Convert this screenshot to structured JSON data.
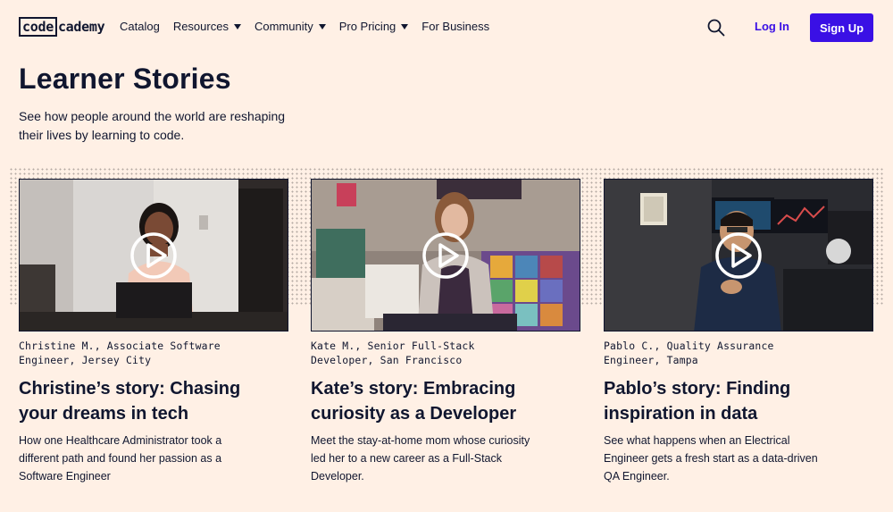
{
  "header": {
    "logo_box": "code",
    "logo_rest": "cademy",
    "nav": [
      {
        "label": "Catalog",
        "dropdown": false
      },
      {
        "label": "Resources",
        "dropdown": true
      },
      {
        "label": "Community",
        "dropdown": true
      },
      {
        "label": "Pro Pricing",
        "dropdown": true
      },
      {
        "label": "For Business",
        "dropdown": false
      }
    ],
    "login": "Log In",
    "signup": "Sign Up"
  },
  "hero": {
    "title": "Learner Stories",
    "subtitle": "See how people around the world are reshaping their lives by learning to code."
  },
  "stories": [
    {
      "meta_line1": "Christine M., Associate Software",
      "meta_line2": "Engineer, Jersey City",
      "title": "Christine’s story: Chasing your dreams in tech",
      "description": "How one Healthcare Administrator took a different path and found her passion as a Software Engineer"
    },
    {
      "meta_line1": "Kate M., Senior Full-Stack",
      "meta_line2": "Developer, San Francisco",
      "title": "Kate’s story: Embracing curiosity as a Developer",
      "description": "Meet the stay-at-home mom whose curiosity led her to a new career as a Full-Stack Developer."
    },
    {
      "meta_line1": "Pablo C., Quality Assurance",
      "meta_line2": "Engineer, Tampa",
      "title": "Pablo’s story: Finding inspiration in data",
      "description": "See what happens when an Electrical Engineer gets a fresh start as a data-driven QA Engineer."
    }
  ],
  "colors": {
    "background": "#fff0e5",
    "text": "#10162f",
    "accent": "#3a10e5"
  },
  "icons": [
    "search-icon",
    "chevron-down-icon",
    "play-icon"
  ]
}
